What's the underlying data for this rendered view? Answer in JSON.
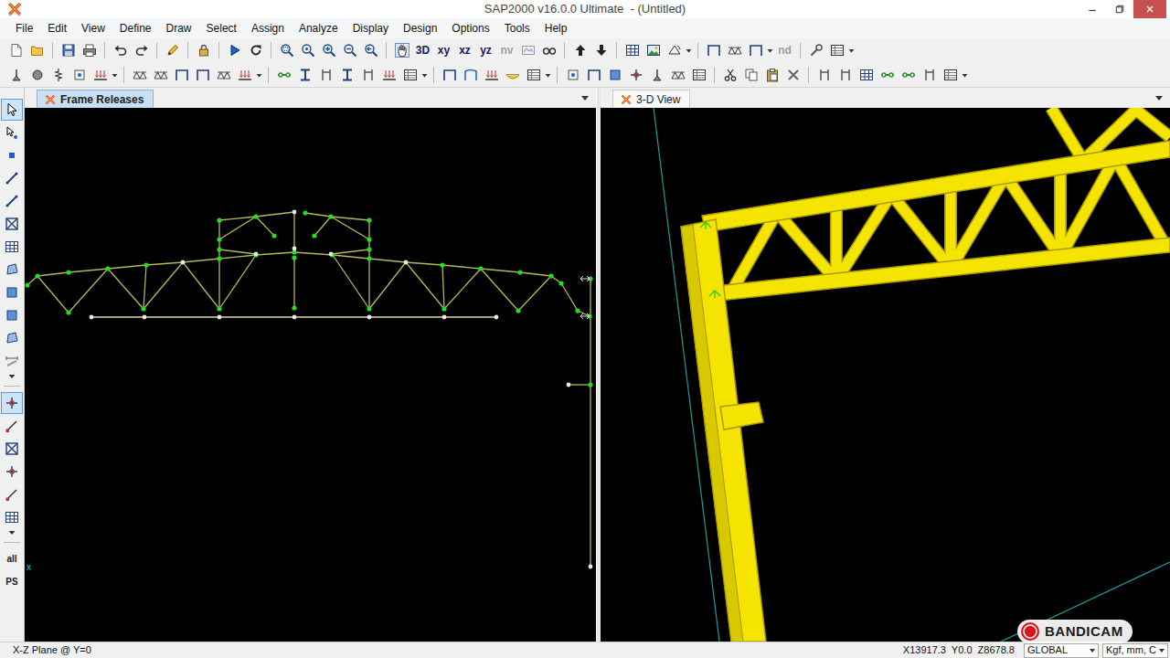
{
  "window": {
    "title": "SAP2000 v16.0.0 Ultimate  - (Untitled)"
  },
  "menu": [
    "File",
    "Edit",
    "View",
    "Define",
    "Draw",
    "Select",
    "Assign",
    "Analyze",
    "Display",
    "Design",
    "Options",
    "Tools",
    "Help"
  ],
  "toolbar_top": [
    {
      "kind": "new",
      "disabled": false
    },
    {
      "kind": "open",
      "disabled": false
    },
    {
      "kind": "sep"
    },
    {
      "kind": "save",
      "disabled": false
    },
    {
      "kind": "print",
      "disabled": false
    },
    {
      "kind": "sep"
    },
    {
      "kind": "undo",
      "disabled": false
    },
    {
      "kind": "redo",
      "disabled": false
    },
    {
      "kind": "sep"
    },
    {
      "kind": "pencil",
      "disabled": false
    },
    {
      "kind": "sep"
    },
    {
      "kind": "lock",
      "disabled": false
    },
    {
      "kind": "sep"
    },
    {
      "kind": "run",
      "disabled": false
    },
    {
      "kind": "rerun",
      "disabled": false
    },
    {
      "kind": "sep"
    },
    {
      "kind": "zoom-window",
      "disabled": false
    },
    {
      "kind": "zoom-restore",
      "disabled": false
    },
    {
      "kind": "zoom-in",
      "disabled": false
    },
    {
      "kind": "zoom-out",
      "disabled": false
    },
    {
      "kind": "zoom-prev",
      "disabled": false
    },
    {
      "kind": "sep"
    },
    {
      "kind": "pan",
      "disabled": false
    },
    {
      "kind": "text",
      "label": "3D",
      "disabled": false
    },
    {
      "kind": "text",
      "label": "xy",
      "disabled": false
    },
    {
      "kind": "text",
      "label": "xz",
      "disabled": false
    },
    {
      "kind": "text",
      "label": "yz",
      "disabled": false
    },
    {
      "kind": "text",
      "label": "nv",
      "disabled": true
    },
    {
      "kind": "set-display",
      "disabled": true
    },
    {
      "kind": "glasses",
      "disabled": false
    },
    {
      "kind": "sep"
    },
    {
      "kind": "up",
      "disabled": false
    },
    {
      "kind": "down",
      "disabled": false
    },
    {
      "kind": "sep"
    },
    {
      "kind": "grid",
      "disabled": false
    },
    {
      "kind": "image",
      "disabled": false
    },
    {
      "kind": "rotate",
      "disabled": false
    },
    {
      "kind": "drop",
      "disabled": false
    },
    {
      "kind": "sep"
    },
    {
      "kind": "frame",
      "disabled": false
    },
    {
      "kind": "truss",
      "disabled": false
    },
    {
      "kind": "frame",
      "disabled": false
    },
    {
      "kind": "drop",
      "disabled": false
    },
    {
      "kind": "text",
      "label": "nd",
      "disabled": true
    },
    {
      "kind": "sep"
    },
    {
      "kind": "tool",
      "disabled": false
    },
    {
      "kind": "table",
      "disabled": false
    },
    {
      "kind": "drop",
      "disabled": false
    }
  ],
  "toolbar_bottom": [
    {
      "kind": "restraint"
    },
    {
      "kind": "mass"
    },
    {
      "kind": "spring"
    },
    {
      "kind": "joint"
    },
    {
      "kind": "load"
    },
    {
      "kind": "drop"
    },
    {
      "kind": "sep"
    },
    {
      "kind": "truss"
    },
    {
      "kind": "truss"
    },
    {
      "kind": "frame"
    },
    {
      "kind": "frame"
    },
    {
      "kind": "truss"
    },
    {
      "kind": "load"
    },
    {
      "kind": "drop"
    },
    {
      "kind": "sep"
    },
    {
      "kind": "release"
    },
    {
      "kind": "section"
    },
    {
      "kind": "column"
    },
    {
      "kind": "section"
    },
    {
      "kind": "column"
    },
    {
      "kind": "load"
    },
    {
      "kind": "table"
    },
    {
      "kind": "drop"
    },
    {
      "kind": "sep"
    },
    {
      "kind": "frame"
    },
    {
      "kind": "deformed"
    },
    {
      "kind": "load"
    },
    {
      "kind": "moment"
    },
    {
      "kind": "table"
    },
    {
      "kind": "drop"
    },
    {
      "kind": "sep"
    },
    {
      "kind": "joint"
    },
    {
      "kind": "frame"
    },
    {
      "kind": "area"
    },
    {
      "kind": "snap"
    },
    {
      "kind": "restraint"
    },
    {
      "kind": "truss"
    },
    {
      "kind": "table"
    },
    {
      "kind": "sep"
    },
    {
      "kind": "cut"
    },
    {
      "kind": "copy"
    },
    {
      "kind": "paste"
    },
    {
      "kind": "delete"
    },
    {
      "kind": "sep"
    },
    {
      "kind": "column"
    },
    {
      "kind": "column"
    },
    {
      "kind": "grid"
    },
    {
      "kind": "release"
    },
    {
      "kind": "release"
    },
    {
      "kind": "column"
    },
    {
      "kind": "table"
    },
    {
      "kind": "drop"
    }
  ],
  "side_toolbar": [
    {
      "kind": "pointer",
      "selected": true
    },
    {
      "kind": "reshape",
      "selected": false
    },
    {
      "kind": "point",
      "selected": false
    },
    {
      "kind": "line",
      "selected": false
    },
    {
      "kind": "line",
      "selected": false
    },
    {
      "kind": "truss-x",
      "selected": false
    },
    {
      "kind": "grid",
      "selected": false
    },
    {
      "kind": "polygon",
      "selected": false
    },
    {
      "kind": "area",
      "selected": false
    },
    {
      "kind": "area",
      "selected": false
    },
    {
      "kind": "polygon",
      "selected": false
    },
    {
      "kind": "dim",
      "selected": false
    },
    {
      "kind": "drop",
      "selected": false
    },
    {
      "kind": "sep",
      "selected": false
    },
    {
      "kind": "snap",
      "selected": true
    },
    {
      "kind": "snap-end",
      "selected": false
    },
    {
      "kind": "truss-x",
      "selected": false
    },
    {
      "kind": "snap",
      "selected": false
    },
    {
      "kind": "snap-end",
      "selected": false
    },
    {
      "kind": "grid",
      "selected": false
    },
    {
      "kind": "drop",
      "selected": false
    },
    {
      "kind": "sep",
      "selected": false
    },
    {
      "kind": "text",
      "label": "all",
      "selected": false
    },
    {
      "kind": "text",
      "label": "PS",
      "selected": false
    }
  ],
  "panes": [
    {
      "tab": "Frame Releases",
      "selected": true,
      "kind": "elevation",
      "axis_label": "x"
    },
    {
      "tab": "3-D View",
      "selected": false,
      "kind": "perspective"
    }
  ],
  "status_bar": {
    "plane": "X-Z Plane @ Y=0",
    "coordinates": "X13917.3  Y0.0  Z8678.8",
    "coord_system": "GLOBAL",
    "units": "Kgf, mm, C"
  },
  "watermark": {
    "text": "BANDICAM"
  }
}
